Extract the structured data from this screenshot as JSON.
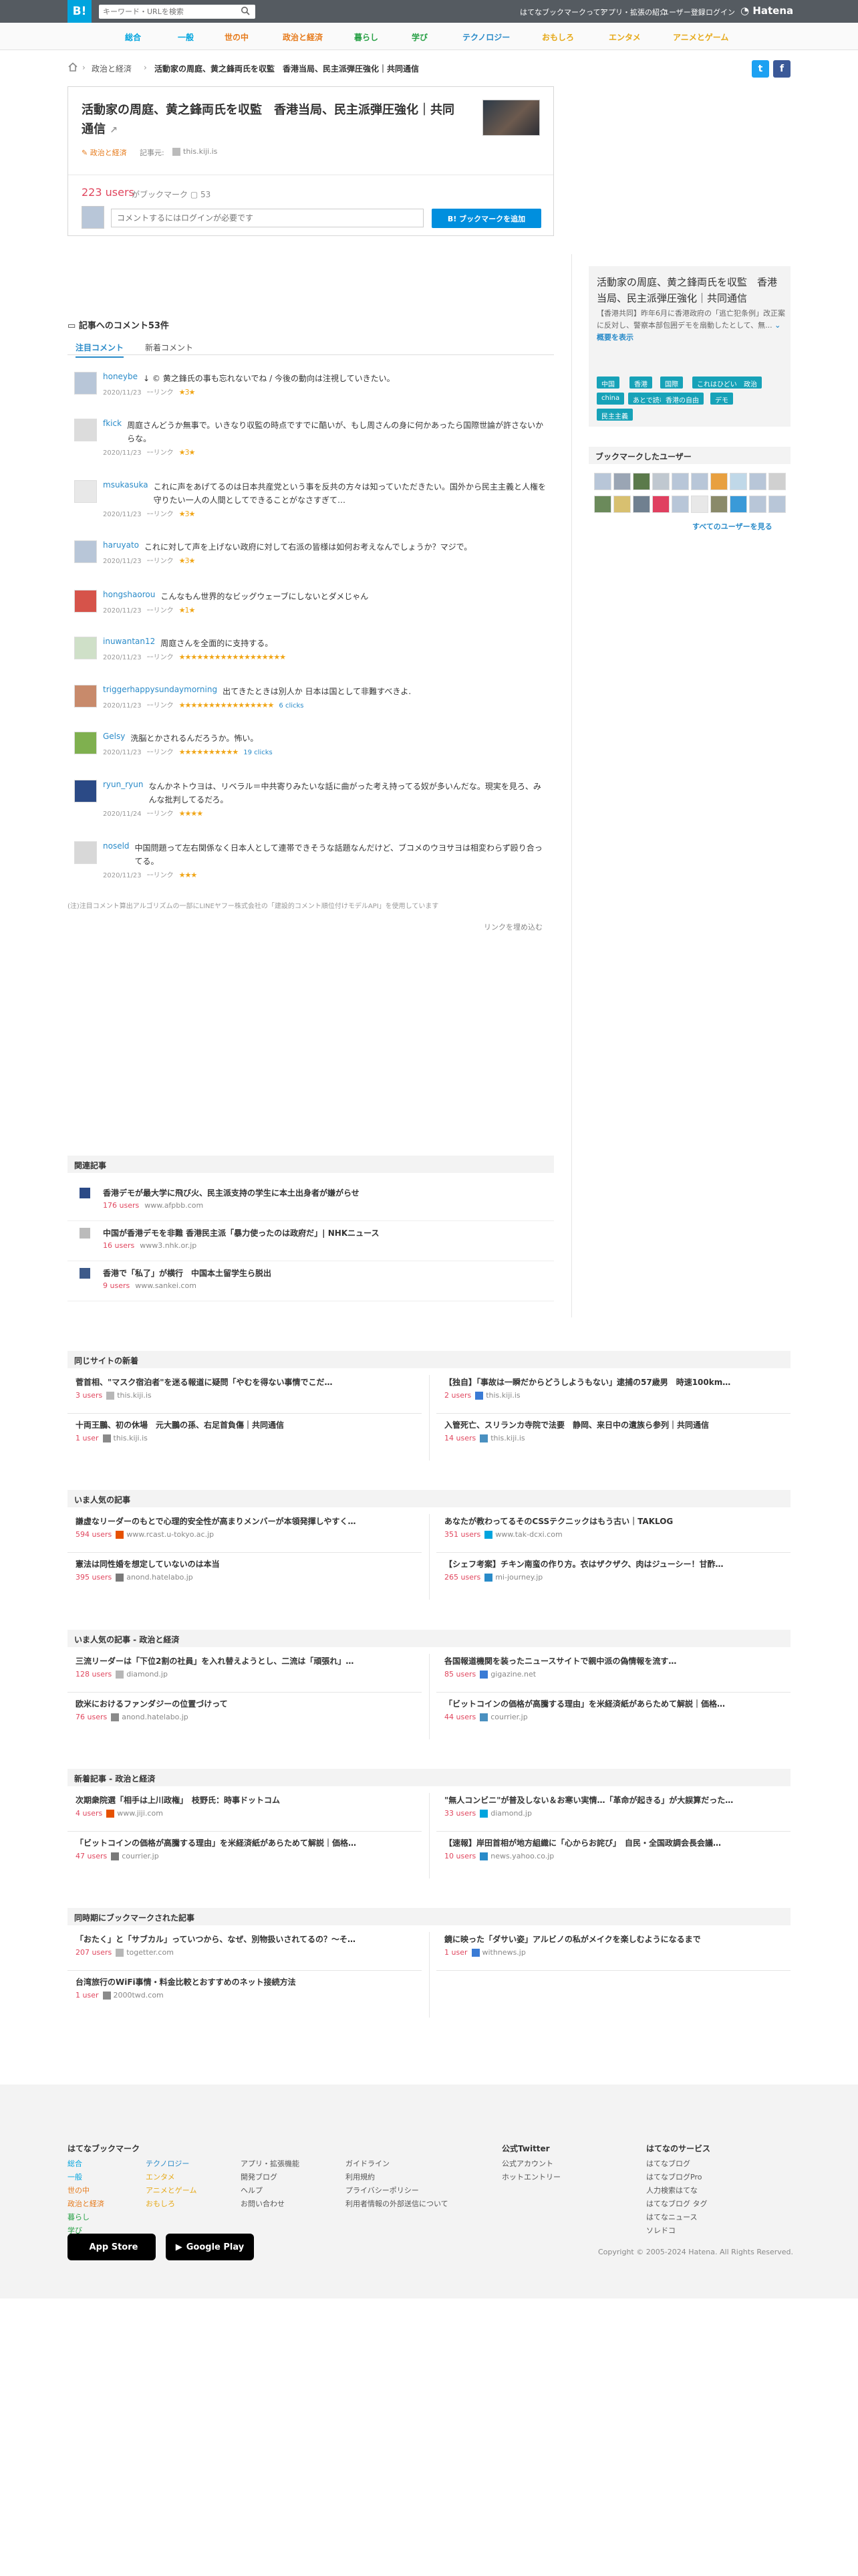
{
  "topbar": {
    "logo": "B!",
    "search_placeholder": "キーワード・URLを検索",
    "links": [
      "はてなブックマークって？",
      "アプリ・拡張の紹介",
      "ユーザー登録",
      "ログイン"
    ],
    "hatena": "Hatena"
  },
  "categories": [
    {
      "label": "総合",
      "color": "#00a4de"
    },
    {
      "label": "一般",
      "color": "#00a4de"
    },
    {
      "label": "世の中",
      "color": "#e67b1c"
    },
    {
      "label": "政治と経済",
      "color": "#e67b1c"
    },
    {
      "label": "暮らし",
      "color": "#27a045"
    },
    {
      "label": "学び",
      "color": "#27a045"
    },
    {
      "label": "テクノロジー",
      "color": "#2a8bc9"
    },
    {
      "label": "おもしろ",
      "color": "#e6a919"
    },
    {
      "label": "エンタメ",
      "color": "#e6a919"
    },
    {
      "label": "アニメとゲーム",
      "color": "#e6a919"
    }
  ],
  "breadcrumb": {
    "items": [
      "政治と経済",
      "活動家の周庭、黄之鋒両氏を収監　香港当局、民主派弾圧強化｜共同通信"
    ]
  },
  "entry": {
    "title": "活動家の周庭、黄之鋒両氏を収監　香港当局、民主派弾圧強化｜共同通信",
    "category": "政治と経済",
    "source_label": "記事元:",
    "source_domain": "this.kiji.is",
    "users": "223 users",
    "bookmark_suffix": "がブックマーク",
    "comment_count": "53",
    "comment_placeholder": "コメントするにはログインが必要です",
    "add_button": "ブックマークを追加"
  },
  "comments_section": {
    "title": "記事へのコメント53件",
    "tabs": [
      "注目コメント",
      "新着コメント"
    ]
  },
  "comments": [
    {
      "user": "honeybe",
      "text": "↓ © 黄之鋒氏の事も忘れないでね / 今後の動向は注視していきたい。",
      "date": "2020/11/23",
      "link": "ｰｰリンク",
      "stars": "★3★",
      "clicks": ""
    },
    {
      "user": "fkick",
      "text": "周庭さんどうか無事で。いきなり収監の時点ですでに酷いが、もし周さんの身に何かあったら国際世論が許さないからな。",
      "date": "2020/11/23",
      "link": "ｰｰリンク",
      "stars": "★3★",
      "clicks": ""
    },
    {
      "user": "msukasuka",
      "text": "これに声をあげてるのは日本共産党という事を反共の方々は知っていただきたい。国外から民主主義と人権を守りたい一人の人間としてできることがなさすぎて…",
      "date": "2020/11/23",
      "link": "ｰｰリンク",
      "stars": "★3★",
      "clicks": ""
    },
    {
      "user": "haruyato",
      "text": "これに対して声を上げない政府に対して右派の皆様は如何お考えなんでしょうか？マジで。",
      "date": "2020/11/23",
      "link": "ｰｰリンク",
      "stars": "★3★",
      "clicks": ""
    },
    {
      "user": "hongshaorou",
      "text": "こんなもん世界的なビッグウェーブにしないとダメじゃん",
      "date": "2020/11/23",
      "link": "ｰｰリンク",
      "stars": "★1★",
      "clicks": ""
    },
    {
      "user": "inuwantan12",
      "text": "周庭さんを全面的に支持する。",
      "date": "2020/11/23",
      "link": "ｰｰリンク",
      "stars": "★★★★★★★★★★★★★★★★★★",
      "clicks": ""
    },
    {
      "user": "triggerhappysundaymorning",
      "text": "出てきたときは別人か 日本は国として非難すべきよ.",
      "date": "2020/11/23",
      "link": "ｰｰリンク",
      "stars": "★★★★★★★★★★★★★★★★",
      "clicks": "6 clicks"
    },
    {
      "user": "Gelsy",
      "text": "洗脳とかされるんだろうか。怖い。",
      "date": "2020/11/23",
      "link": "ｰｰリンク",
      "stars": "★★★★★★★★★★",
      "clicks": "19 clicks"
    },
    {
      "user": "ryun_ryun",
      "text": "なんかネトウヨは、リベラル＝中共寄りみたいな話に曲がった考え持ってる奴が多いんだな。現実を見ろ、みんな批判してるだろ。",
      "date": "2020/11/24",
      "link": "ｰｰリンク",
      "stars": "★★★★",
      "clicks": ""
    },
    {
      "user": "noseld",
      "text": "中国問題って左右関係なく日本人として連帯できそうな話題なんだけど、ブコメのウヨサヨは相変わらず殴り合ってる。",
      "date": "2020/11/23",
      "link": "ｰｰリンク",
      "stars": "★★★",
      "clicks": ""
    }
  ],
  "notice": "(注)注目コメント算出アルゴリズムの一部にLINEヤフー株式会社の「建設的コメント順位付けモデルAPI」を使用しています",
  "hide_links": "リンクを埋め込む",
  "related": {
    "title": "関連記事",
    "items": [
      {
        "title": "香港デモが最大学に飛び火、民主派支持の学生に本土出身者が嫌がらせ",
        "users": "176 users",
        "domain": "www.afpbb.com"
      },
      {
        "title": "中国が香港デモを非難 香港民主派「暴力使ったのは政府だ」| NHKニュース",
        "users": "16 users",
        "domain": "www3.nhk.or.jp"
      },
      {
        "title": "香港で「私了」が横行　中国本土留学生ら脱出",
        "users": "9 users",
        "domain": "www.sankei.com"
      }
    ]
  },
  "sidebar": {
    "title": "活動家の周庭、黄之鋒両氏を収監　香港当局、民主派弾圧強化｜共同通信",
    "desc": "【香港共同】昨年6月に香港政府の「逃亡犯条例」改正案に反対し、警察本部包囲デモを扇動したとして、無...",
    "more": "概要を表示",
    "tags": [
      "中国",
      "香港",
      "国際",
      "これはひどい",
      "政治",
      "china",
      "あとで読む",
      "香港の自由",
      "デモ",
      "民主主義"
    ],
    "bm_users_title": "ブックマークしたユーザー",
    "all_users": "すべてのユーザーを見る"
  },
  "sections": [
    {
      "title": "同じサイトの新着",
      "items": [
        {
          "title": "菅首相、\"マスク宿泊者\"を迷る報道に疑問「やむを得ない事情でこだ…",
          "users": "3 users",
          "domain": "this.kiji.is"
        },
        {
          "title": "【独自】「事故は一瞬だからどうしようもない」逮捕の57歳男　時速100km…",
          "users": "2 users",
          "domain": "this.kiji.is"
        },
        {
          "title": "十両王鵬、初の休場　元大鵬の孫、右足首負傷｜共同通信",
          "users": "1 user",
          "domain": "this.kiji.is"
        },
        {
          "title": "入管死亡、スリランカ寺院で法要　静岡、来日中の遺族ら参列｜共同通信",
          "users": "14 users",
          "domain": "this.kiji.is"
        }
      ]
    },
    {
      "title": "いま人気の記事",
      "items": [
        {
          "title": "謙虚なリーダーのもとで心理的安全性が高まりメンバーが本領発揮しやすく…",
          "users": "594 users",
          "domain": "www.rcast.u-tokyo.ac.jp"
        },
        {
          "title": "あなたが教わってるそのCSSテクニックはもう古い｜TAKLOG",
          "users": "351 users",
          "domain": "www.tak-dcxi.com"
        },
        {
          "title": "憲法は同性婚を想定していないのは本当",
          "users": "395 users",
          "domain": "anond.hatelabo.jp"
        },
        {
          "title": "【シェフ考案】チキン南蛮の作り方。衣はザクザク、肉はジューシー！甘酢…",
          "users": "265 users",
          "domain": "mi-journey.jp"
        }
      ]
    },
    {
      "title": "いま人気の記事 - 政治と経済",
      "items": [
        {
          "title": "三流リーダーは「下位2割の社員」を入れ替えようとし、二流は「頑張れ」…",
          "users": "128 users",
          "domain": "diamond.jp"
        },
        {
          "title": "各国報道機関を装ったニュースサイトで親中派の偽情報を流す…",
          "users": "85 users",
          "domain": "gigazine.net"
        },
        {
          "title": "欧米におけるファンダジーの位置づけって",
          "users": "76 users",
          "domain": "anond.hatelabo.jp"
        },
        {
          "title": "「ビットコインの価格が高騰する理由」を米経済紙があらためて解説｜価格…",
          "users": "44 users",
          "domain": "courrier.jp"
        }
      ]
    },
    {
      "title": "新着記事 - 政治と経済",
      "items": [
        {
          "title": "次期衆院選「相手は上川政権」　枝野氏：時事ドットコム",
          "users": "4 users",
          "domain": "www.jiji.com"
        },
        {
          "title": "\"無人コンビニ\"が普及しない＆お寒い実情…「革命が起きる」が大誤算だった…",
          "users": "33 users",
          "domain": "diamond.jp"
        },
        {
          "title": "「ビットコインの価格が高騰する理由」を米経済紙があらためて解説｜価格…",
          "users": "47 users",
          "domain": "courrier.jp"
        },
        {
          "title": "【速報】岸田首相が地方組織に「心からお詫び」　自民・全国政調会長会議…",
          "users": "10 users",
          "domain": "news.yahoo.co.jp"
        }
      ]
    },
    {
      "title": "同時期にブックマークされた記事",
      "items": [
        {
          "title": "「おたく」と「サブカル」っていつから、なぜ、別物扱いされてるの？〜そ…",
          "users": "207 users",
          "domain": "togetter.com"
        },
        {
          "title": "鏡に映った「ダサい姿」アルビノの私がメイクを楽しむようになるまで",
          "users": "1 user",
          "domain": "withnews.jp"
        },
        {
          "title": "台湾旅行のWiFi事情・料金比較とおすすめのネット接続方法",
          "users": "1 user",
          "domain": "2000twd.com"
        }
      ]
    }
  ],
  "footer": {
    "col1_title": "はてなブックマーク",
    "col1a": [
      "総合",
      "一般",
      "世の中",
      "政治と経済",
      "暮らし",
      "学び"
    ],
    "col1b": [
      "テクノロジー",
      "エンタメ",
      "アニメとゲーム",
      "おもしろ"
    ],
    "col2": [
      "アプリ・拡張機能",
      "開発ブログ",
      "ヘルプ",
      "お問い合わせ"
    ],
    "col3": [
      "ガイドライン",
      "利用規約",
      "プライバシーポリシー",
      "利用者情報の外部送信について"
    ],
    "twitter_title": "公式Twitter",
    "twitter": [
      "公式アカウント",
      "ホットエントリー"
    ],
    "services_title": "はてなのサービス",
    "services": [
      "はてなブログ",
      "はてなブログPro",
      "人力検索はてな",
      "はてなブログ タグ",
      "はてなニュース",
      "ソレドコ"
    ],
    "app_store": "App Store",
    "google_play": "Google Play",
    "copyright": "Copyright © 2005-2024 Hatena. All Rights Reserved."
  }
}
